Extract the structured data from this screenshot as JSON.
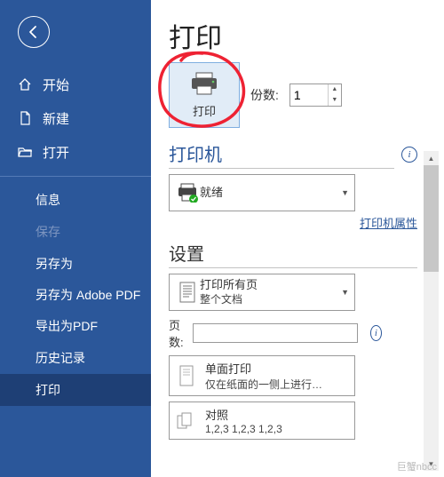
{
  "sidebar": {
    "items": [
      {
        "label": "开始"
      },
      {
        "label": "新建"
      },
      {
        "label": "打开"
      },
      {
        "label": "信息"
      },
      {
        "label": "保存"
      },
      {
        "label": "另存为"
      },
      {
        "label": "另存为 Adobe PDF"
      },
      {
        "label": "导出为PDF"
      },
      {
        "label": "历史记录"
      },
      {
        "label": "打印"
      }
    ]
  },
  "main": {
    "title": "打印",
    "print_button_label": "打印",
    "copies_label": "份数:",
    "copies_value": "1",
    "printer_section": "打印机",
    "printer_status": "就绪",
    "printer_props_link": "打印机属性",
    "settings_section": "设置",
    "print_scope": {
      "line1": "打印所有页",
      "line2": "整个文档"
    },
    "pages_label": "页数:",
    "pages_value": "",
    "single_side": {
      "line1": "单面打印",
      "line2": "仅在纸面的一侧上进行…"
    },
    "collate": {
      "line1": "对照",
      "line2": "1,2,3    1,2,3    1,2,3"
    }
  },
  "watermark": "巨蟹nbcc"
}
